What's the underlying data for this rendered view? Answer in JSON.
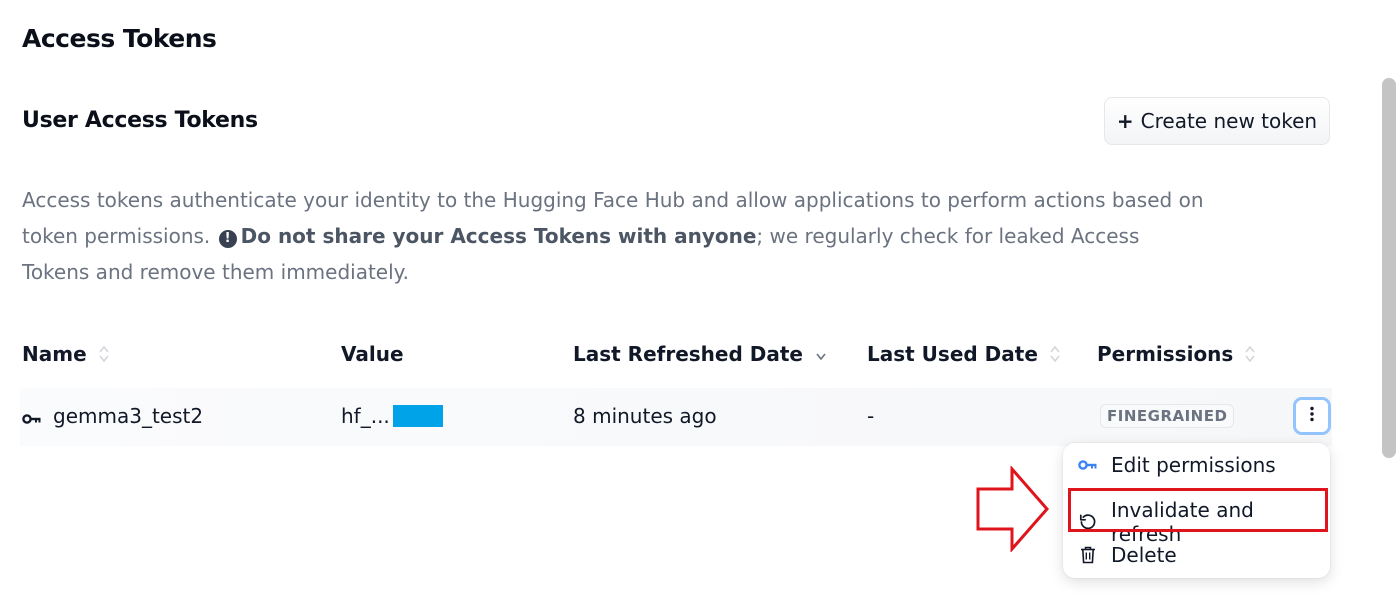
{
  "page": {
    "title": "Access Tokens"
  },
  "section": {
    "title": "User Access Tokens",
    "create_button_plus": "+",
    "create_button_label": "Create new token"
  },
  "description": {
    "part1": "Access tokens authenticate your identity to the Hugging Face Hub and allow applications to perform actions based on token permissions.",
    "warning_bold": "Do not share your Access Tokens with anyone",
    "part2": "; we regularly check for leaked Access Tokens and remove them immediately."
  },
  "table": {
    "headers": {
      "name": "Name",
      "value": "Value",
      "last_refreshed": "Last Refreshed Date",
      "last_used": "Last Used Date",
      "permissions": "Permissions"
    },
    "rows": [
      {
        "name": "gemma3_test2",
        "value": "hf_...",
        "last_refreshed": "8 minutes ago",
        "last_used": "-",
        "permission": "FINEGRAINED"
      }
    ]
  },
  "menu": {
    "items": [
      {
        "label": "Edit permissions",
        "icon": "key-icon"
      },
      {
        "label": "Invalidate and refresh",
        "icon": "refresh-icon"
      },
      {
        "label": "Delete",
        "icon": "trash-icon"
      }
    ]
  },
  "colors": {
    "accent_blue": "#3b82f6",
    "annotation_red": "#e0141c",
    "masked_value": "#00a2e8"
  }
}
